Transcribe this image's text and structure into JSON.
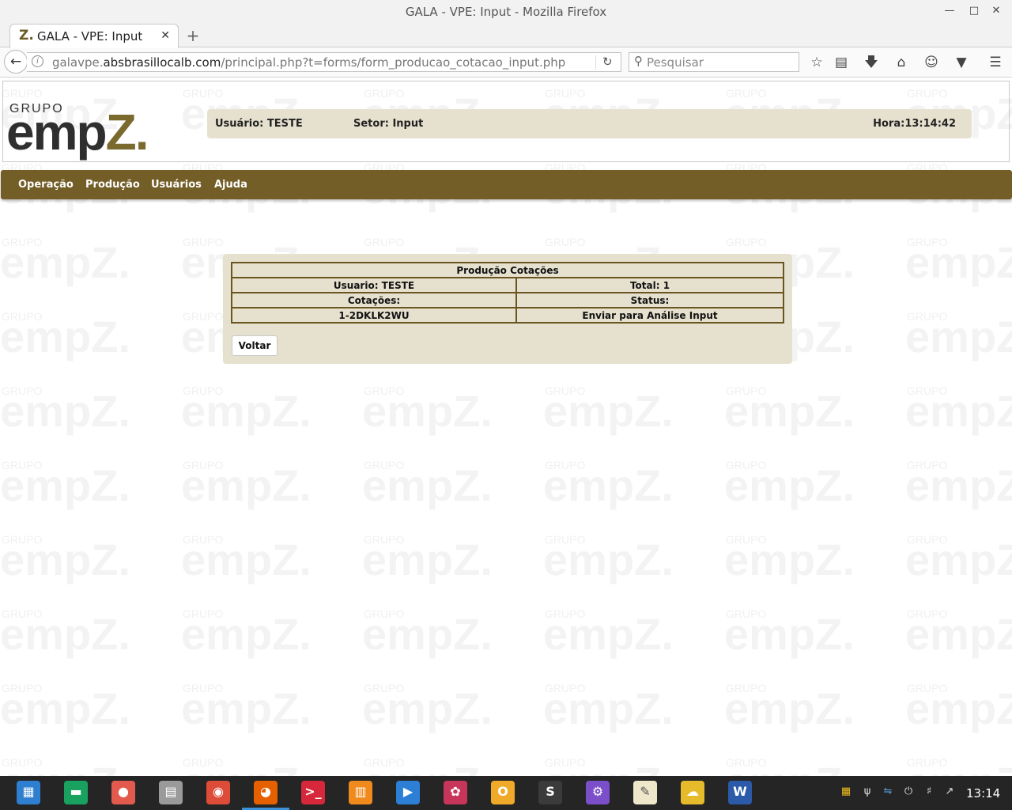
{
  "window": {
    "title": "GALA - VPE: Input - Mozilla Firefox",
    "controls": {
      "minimize": "—",
      "maximize": "□",
      "close": "✕"
    }
  },
  "tab": {
    "favicon": "Z.",
    "label": "GALA - VPE: Input",
    "close": "✕",
    "new_tab": "+"
  },
  "nav": {
    "url_prefix": "galavpe.",
    "url_domain": "absbrasillocalb.com",
    "url_path": "/principal.php?t=forms/form_producao_cotacao_input.php",
    "search_placeholder": "Pesquisar"
  },
  "toolbar_icons": [
    "bookmark-star-icon",
    "reading-list-icon",
    "download-icon",
    "home-icon",
    "chat-icon",
    "pocket-icon",
    "hamburger-menu-icon"
  ],
  "header": {
    "logo_small": "GRUPO",
    "logo_main": "emp",
    "logo_z": "Z.",
    "usuario": "Usuário: TESTE",
    "setor": "Setor: Input",
    "hora": "Hora:13:14:42"
  },
  "menu": {
    "items": [
      "Operação",
      "Produção",
      "Usuários",
      "Ajuda"
    ]
  },
  "panel": {
    "title": "Produção Cotações",
    "rows": [
      [
        "Usuario: TESTE",
        "Total: 1"
      ],
      [
        "Cotações:",
        "Status:"
      ],
      [
        "1-2DKLK2WU",
        "Enviar para Análise Input"
      ]
    ],
    "button": "Voltar"
  },
  "taskbar": {
    "apps": [
      {
        "name": "launcher-icon",
        "glyph": "▦",
        "color": "#2f7fd1"
      },
      {
        "name": "file-manager-icon",
        "glyph": "▬",
        "color": "#19a15f"
      },
      {
        "name": "screen-recorder-icon",
        "glyph": "●",
        "color": "#e25a4e"
      },
      {
        "name": "archive-icon",
        "glyph": "▤",
        "color": "#9a9a9a"
      },
      {
        "name": "chrome-icon",
        "glyph": "◉",
        "color": "#dd4b39"
      },
      {
        "name": "firefox-icon",
        "glyph": "◕",
        "color": "#e66000"
      },
      {
        "name": "terminal-icon",
        "glyph": ">_",
        "color": "#d6283a"
      },
      {
        "name": "app-store-icon",
        "glyph": "▥",
        "color": "#f08a1c"
      },
      {
        "name": "video-player-icon",
        "glyph": "▶",
        "color": "#2d7fd6"
      },
      {
        "name": "settings-icon",
        "glyph": "✿",
        "color": "#c7365a"
      },
      {
        "name": "outlook-icon",
        "glyph": "O",
        "color": "#f0a928"
      },
      {
        "name": "sublime-text-icon",
        "glyph": "S",
        "color": "#3b3b3b"
      },
      {
        "name": "dev-tools-icon",
        "glyph": "⚙",
        "color": "#7b4fc9"
      },
      {
        "name": "text-editor-icon",
        "glyph": "✎",
        "color": "#efe7c9"
      },
      {
        "name": "cloud-drive-icon",
        "glyph": "☁",
        "color": "#e5bb2b"
      },
      {
        "name": "word-icon",
        "glyph": "W",
        "color": "#2b5aa8"
      }
    ],
    "tray": [
      "stack-icon",
      "usb-icon",
      "teamviewer-icon",
      "power-icon",
      "volume-icon",
      "network-icon"
    ],
    "clock": "13:14"
  },
  "colors": {
    "menu_bg": "#735e27",
    "panel_bg": "#e6e1cf",
    "table_border": "#6a5520"
  }
}
